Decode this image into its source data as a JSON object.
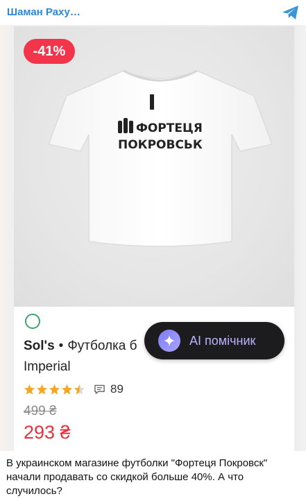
{
  "channel": {
    "title": "Шаман Раху…",
    "icon": "telegram-icon"
  },
  "product": {
    "discount_badge": "-41%",
    "brand": "Sol's",
    "separator": "•",
    "title_rest": "Футболка б",
    "subtitle": "Imperial",
    "rating": 4.5,
    "max_rating": 5,
    "comment_count": "89",
    "old_price": "499 ₴",
    "new_price": "293 ₴",
    "print_line1": "ФОРТЕЦЯ",
    "print_line2": "ПОКРОВСЬК"
  },
  "assistant_button": {
    "label": "AI помічник"
  },
  "caption": "В украинском магазине футболки \"Фортеця Покровск\" начали продавать со скидкой больше 40%. А что случилось?",
  "colors": {
    "channel_title": "#2e87d1",
    "discount": "#f2354a",
    "price": "#e4313d",
    "star": "#f5a623",
    "ai_button_bg": "#1c1c1e",
    "ai_label": "#b8b3ff"
  }
}
